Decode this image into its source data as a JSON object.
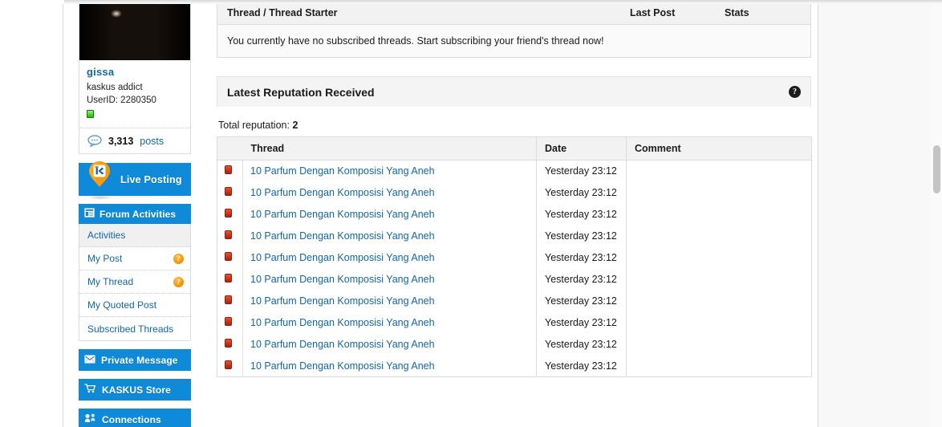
{
  "profile": {
    "avatar_alt": "user-avatar",
    "username": "gissa",
    "user_title": "kaskus addict",
    "userid_label": "UserID: 2280350",
    "online_status": "online",
    "posts_count": "3,313",
    "posts_label": "posts",
    "bubble_icon": "speech-bubble-icon"
  },
  "sidebar": {
    "live_posting": {
      "label": "Live Posting",
      "icon": "kaskus-pin-icon"
    },
    "forum_activities": {
      "header": "Forum Activities",
      "header_icon": "forum-board-icon",
      "items": [
        {
          "label": "Activities",
          "active": true,
          "badge": ""
        },
        {
          "label": "My Post",
          "active": false,
          "badge": "?"
        },
        {
          "label": "My Thread",
          "active": false,
          "badge": "?"
        },
        {
          "label": "My Quoted Post",
          "active": false,
          "badge": ""
        },
        {
          "label": "Subscribed Threads",
          "active": false,
          "badge": ""
        }
      ]
    },
    "solo_items": [
      {
        "label": "Private Message",
        "icon": "envelope-icon"
      },
      {
        "label": "KASKUS Store",
        "icon": "shopping-cart-icon"
      },
      {
        "label": "Connections",
        "icon": "connections-icon"
      }
    ]
  },
  "subscribed_panel": {
    "columns": {
      "thread": "Thread / Thread Starter",
      "last_post": "Last Post",
      "stats": "Stats"
    },
    "empty_message": "You currently have no subscribed threads. Start subscribing your friend's thread now!"
  },
  "reputation_panel": {
    "title": "Latest Reputation Received",
    "help_icon": "help-question-icon",
    "total_label": "Total reputation:",
    "total_value": "2",
    "columns": {
      "icon": "",
      "thread": "Thread",
      "date": "Date",
      "comment": "Comment"
    },
    "rows": [
      {
        "icon": "reputation-negative-icon",
        "thread": "10 Parfum Dengan Komposisi Yang Aneh",
        "date": "Yesterday 23:12",
        "comment": ""
      },
      {
        "icon": "reputation-negative-icon",
        "thread": "10 Parfum Dengan Komposisi Yang Aneh",
        "date": "Yesterday 23:12",
        "comment": ""
      },
      {
        "icon": "reputation-negative-icon",
        "thread": "10 Parfum Dengan Komposisi Yang Aneh",
        "date": "Yesterday 23:12",
        "comment": ""
      },
      {
        "icon": "reputation-negative-icon",
        "thread": "10 Parfum Dengan Komposisi Yang Aneh",
        "date": "Yesterday 23:12",
        "comment": ""
      },
      {
        "icon": "reputation-negative-icon",
        "thread": "10 Parfum Dengan Komposisi Yang Aneh",
        "date": "Yesterday 23:12",
        "comment": ""
      },
      {
        "icon": "reputation-negative-icon",
        "thread": "10 Parfum Dengan Komposisi Yang Aneh",
        "date": "Yesterday 23:12",
        "comment": ""
      },
      {
        "icon": "reputation-negative-icon",
        "thread": "10 Parfum Dengan Komposisi Yang Aneh",
        "date": "Yesterday 23:12",
        "comment": ""
      },
      {
        "icon": "reputation-negative-icon",
        "thread": "10 Parfum Dengan Komposisi Yang Aneh",
        "date": "Yesterday 23:12",
        "comment": ""
      },
      {
        "icon": "reputation-negative-icon",
        "thread": "10 Parfum Dengan Komposisi Yang Aneh",
        "date": "Yesterday 23:12",
        "comment": ""
      },
      {
        "icon": "reputation-negative-icon",
        "thread": "10 Parfum Dengan Komposisi Yang Aneh",
        "date": "Yesterday 23:12",
        "comment": ""
      }
    ]
  },
  "colors": {
    "brand_blue": "#0e8ad8",
    "link_blue": "#1267a8",
    "badge_orange": "#f59b11",
    "rep_red": "#c9331c",
    "panel_gray": "#f2f2f2",
    "border_gray": "#dcdcdc"
  },
  "scrollbar": {
    "name": "vertical-scrollbar"
  }
}
